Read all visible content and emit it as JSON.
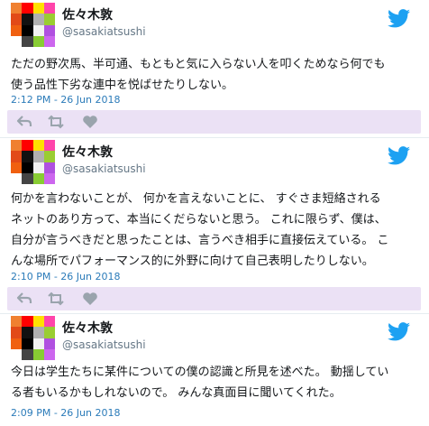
{
  "colors": {
    "name": "#14171a",
    "handle": "#657786",
    "date": "#2b7bb9",
    "action_bar": "#ebe1f5",
    "action_icon": "#9aa4ad",
    "twitter_blue": "#1da1f2"
  },
  "avatar_colors": [
    "#f08030",
    "#ff0000",
    "#ffe000",
    "#ff44aa",
    "#e24a18",
    "#111111",
    "#b0b0b0",
    "#9acd32",
    "#f06010",
    "#000000",
    "#f2f2f2",
    "#b050e0",
    "#ffffff",
    "#444444",
    "#88cc33",
    "#cc66ee"
  ],
  "tweets": [
    {
      "name": "佐々木敦",
      "handle": "@sasakiatsushi",
      "text": "ただの野次馬、半可通、もともと気に入らない人を叩くためなら何でも\n使う品性下劣な連中を悦ばせたりしない。",
      "date": "2:12 PM - 26 Jun 2018",
      "icons": [
        "reply-icon",
        "retweet-icon",
        "heart-icon"
      ]
    },
    {
      "name": "佐々木敦",
      "handle": "@sasakiatsushi",
      "text": "何かを言わないことが、 何かを言えないことに、 すぐさま短絡される\nネットのあり方って、本当にくだらないと思う。 これに限らず、僕は、\n自分が言うべきだと思ったことは、言うべき相手に直接伝えている。 こ\nんな場所でパフォーマンス的に外野に向けて自己表明したりしない。",
      "date": "2:10 PM - 26 Jun 2018",
      "icons": [
        "reply-icon",
        "retweet-icon",
        "heart-icon"
      ]
    },
    {
      "name": "佐々木敦",
      "handle": "@sasakiatsushi",
      "text": "今日は学生たちに某件についての僕の認識と所見を述べた。 動揺してい\nる者もいるかもしれないので。 みんな真面目に聞いてくれた。",
      "date": "2:09 PM - 26 Jun 2018"
    }
  ]
}
